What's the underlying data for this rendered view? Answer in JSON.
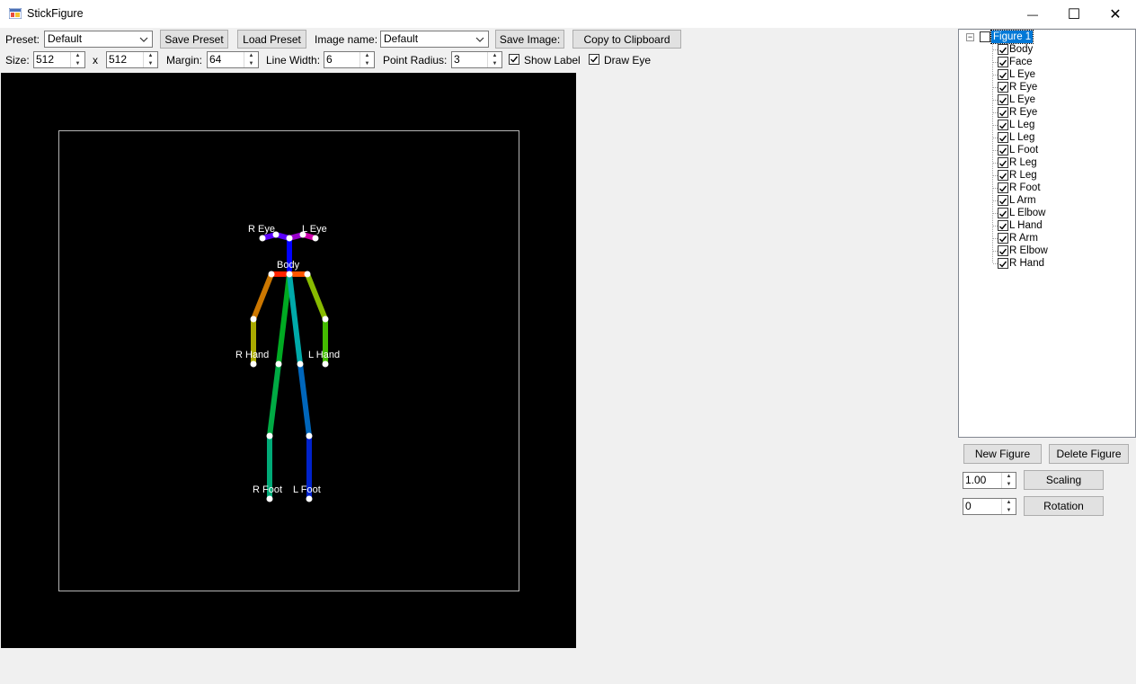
{
  "window": {
    "title": "StickFigure",
    "minimize_glyph": "—",
    "maximize_glyph": "☐",
    "close_glyph": "✕"
  },
  "toolbar": {
    "preset_label": "Preset:",
    "preset_value": "Default",
    "save_preset": "Save Preset",
    "load_preset": "Load Preset",
    "image_name_label": "Image name:",
    "image_name_value": "Default",
    "save_image": "Save Image:",
    "copy_clipboard": "Copy to Clipboard",
    "size_label": "Size:",
    "size_w": "512",
    "size_x": "x",
    "size_h": "512",
    "margin_label": "Margin:",
    "margin_value": "64",
    "line_width_label": "Line Width:",
    "line_width_value": "6",
    "point_radius_label": "Point Radius:",
    "point_radius_value": "3",
    "show_label": "Show Label",
    "show_label_checked": true,
    "draw_eye": "Draw Eye",
    "draw_eye_checked": true
  },
  "figure_labels": {
    "r_eye": "R Eye",
    "l_eye": "L Eye",
    "body": "Body",
    "r_hand": "R Hand",
    "l_hand": "L Hand",
    "r_foot": "R Foot",
    "l_foot": "L Foot"
  },
  "limb_colors": {
    "head_left": "#5a00ff",
    "head_right": "#9900cc",
    "eye_right": "#cc00aa",
    "neck": "#0000ff",
    "shoulder_left": "#ff2200",
    "shoulder_right": "#ff5500",
    "r_upper_arm": "#cc7700",
    "r_forearm": "#aaaa00",
    "l_upper_arm": "#88bb00",
    "l_forearm": "#44bb00",
    "r_torso": "#00aa22",
    "r_thigh": "#00aa44",
    "r_shin": "#00aa77",
    "l_torso": "#00aaaa",
    "l_thigh": "#0066bb",
    "l_shin": "#0022cc",
    "point": "#ffffff",
    "margin_frame": "#b4b4b4"
  },
  "tree": {
    "root": "Figure 1",
    "collapse_glyph": "−",
    "items": [
      "Body",
      "Face",
      "L Eye",
      "R Eye",
      "L Eye",
      "R Eye",
      "L Leg",
      "L Leg",
      "L Foot",
      "R Leg",
      "R Leg",
      "R Foot",
      "L Arm",
      "L Elbow",
      "L Hand",
      "R Arm",
      "R Elbow",
      "R Hand"
    ]
  },
  "side": {
    "new_figure": "New Figure",
    "delete_figure": "Delete Figure",
    "scale_value": "1.00",
    "scaling": "Scaling",
    "rotation_value": "0",
    "rotation": "Rotation"
  }
}
